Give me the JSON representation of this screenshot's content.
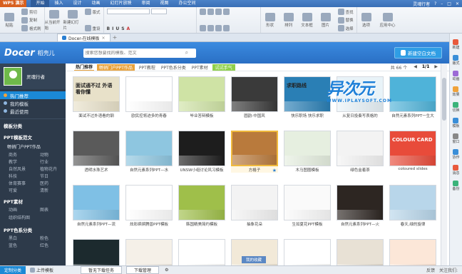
{
  "titlebar": {
    "app_label": "WPS 演示",
    "menus": [
      "开始",
      "插入",
      "设计",
      "动画",
      "幻灯片放映",
      "审阅",
      "视图",
      "办公空间"
    ],
    "active_menu": 0,
    "right_user": "灵魂行者",
    "right_icons": [
      "help-icon",
      "minimize-icon",
      "maximize-icon",
      "close-icon"
    ]
  },
  "ribbon": {
    "paste": "粘贴",
    "cut": "剪切",
    "copy": "复制",
    "format_painter": "格式刷",
    "from_current": "从当前开始",
    "new_slide": "新建幻灯片",
    "reset": "重设",
    "section": "版式",
    "font_name": "",
    "font_size": "",
    "format_chars": [
      "B",
      "I",
      "U",
      "S",
      "A"
    ],
    "shape": "形状",
    "arrange": "排列",
    "textbox": "文本框",
    "picture": "图片",
    "replace": "替换",
    "select": "选择",
    "find": "查找",
    "options": "选项",
    "app_center": "应用中心"
  },
  "tabs": {
    "doc_tab": "Docer-在线模板",
    "close": "×",
    "add": "+"
  },
  "header": {
    "logo_en": "Docer",
    "logo_cn": "稻壳儿",
    "search_placeholder": "搜索您想要找的模板、范文",
    "new_blank": "新建空白文档"
  },
  "sidebar": {
    "user": "灵魂行者",
    "nav": [
      "热门推荐",
      "我的模板",
      "最近使用"
    ],
    "sec1": "模板分类",
    "ppt_title": "PPT模板范文",
    "ppt_sub": "畅销门户PPT作品",
    "ppt_cats": [
      "商务",
      "动物",
      "教学",
      "行业",
      "自然风景",
      "植物花卉",
      "科技",
      "节日",
      "体育赛事",
      "医药",
      "可爱",
      "清新"
    ],
    "sec2": "PPT素材",
    "mat_cats": [
      "动画",
      "图表"
    ],
    "mat_sub": "组织结构图",
    "sec3": "PPT色系分类",
    "color_cats": [
      "黑白",
      "粉色",
      "蓝色",
      "红色"
    ]
  },
  "filter": {
    "items": [
      "热门推荐",
      "畅销门户PPT作品",
      "PPT教程",
      "PPT色系分类",
      "PPT素材",
      "试试手气"
    ],
    "count": "共 66 个",
    "page": "1/1"
  },
  "cards": [
    {
      "label": "面试不过外语看的钢",
      "color": "#e8e1c9",
      "img": "面试通不过 外语看你懂"
    },
    {
      "label": "欧民控将迹多的青春",
      "color": "#ffffff",
      "img": ""
    },
    {
      "label": "毕业答辩模板",
      "color": "#cfe3a5",
      "img": ""
    },
    {
      "label": "圆韵-中国风",
      "color": "#3a3a3a",
      "img": ""
    },
    {
      "label": "快乐职场 快乐求职",
      "color": "#2a7fb5",
      "img": "求职路线"
    },
    {
      "label": "从复日投奏写表格的",
      "color": "#e9f3f8",
      "img": ""
    },
    {
      "label": "自然元素系列PPT一生大",
      "color": "#4fb3d9",
      "img": ""
    },
    {
      "label": "透明水珠艺术",
      "color": "#5a5a5a",
      "img": ""
    },
    {
      "label": "自然元素系列PPT—水",
      "color": "#8ec6e0",
      "img": ""
    },
    {
      "label": "UNSW小组讨论风习模板",
      "color": "#1d1d1d",
      "img": ""
    },
    {
      "label": "方格子",
      "color": "#b97a3c",
      "img": ""
    },
    {
      "label": "木马图圈模板",
      "color": "#e6efe0",
      "img": ""
    },
    {
      "label": "绿色金着茶",
      "color": "#f3f3f3",
      "img": ""
    },
    {
      "label": "coloured slides",
      "color": "#e84b3a",
      "img": "COLOUR CARD"
    },
    {
      "label": "自然元素系列PPT—流",
      "color": "#7fc0e5",
      "img": ""
    },
    {
      "label": "炫彩缤缤腾兽PPT模板",
      "color": "#ffffff",
      "img": ""
    },
    {
      "label": "韩国精美简约模板",
      "color": "#9fbf4a",
      "img": ""
    },
    {
      "label": "抽象花朵",
      "color": "#f3f3f3",
      "img": ""
    },
    {
      "label": "生如夏花PPT模板",
      "color": "#fafafa",
      "img": ""
    },
    {
      "label": "自然元素系列PPT—火",
      "color": "#2d2622",
      "img": ""
    },
    {
      "label": "春天,绿的旋律",
      "color": "#b8d6ea",
      "img": ""
    },
    {
      "label": "",
      "color": "#1c2a2e",
      "img": ""
    },
    {
      "label": "",
      "color": "#f5f0e8",
      "img": ""
    },
    {
      "label": "",
      "color": "#ffffff",
      "img": ""
    },
    {
      "label": "",
      "color": "#f2e9d8",
      "img": ""
    },
    {
      "label": "",
      "color": "#ffffff",
      "img": ""
    },
    {
      "label": "",
      "color": "#e8e1d5",
      "img": ""
    },
    {
      "label": "",
      "color": "#fce7d8",
      "img": ""
    }
  ],
  "recent_tab": "我的收藏",
  "watermark": {
    "cn": "异次元",
    "url": "WWW.IPLAYSOFT.COM"
  },
  "rpanel": [
    "新建",
    "版式",
    "动画",
    "效果",
    "切换",
    "模板",
    "窗口",
    "协作",
    "消息",
    "备份"
  ],
  "status": {
    "custom": "定制分类",
    "upload": "上传模板",
    "pause": "暂无下载任务",
    "download": "下载管理",
    "right": [
      "反馈",
      "关注我们:"
    ]
  }
}
